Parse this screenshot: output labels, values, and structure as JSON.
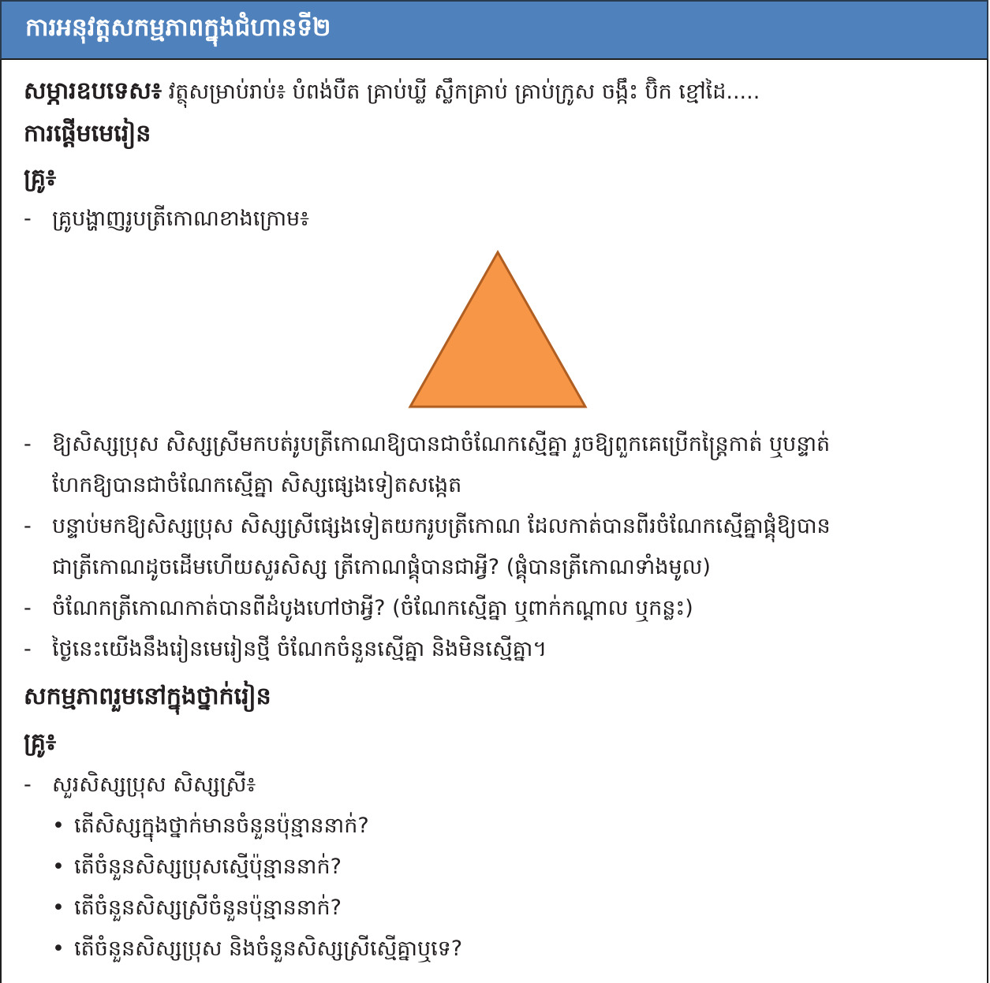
{
  "header": {
    "title": "ការអនុវត្តសកម្មភាពក្នុងជំហានទី២"
  },
  "materials": {
    "label": "សម្ភារឧបទេស៖",
    "text": "វត្ថុសម្រាប់រាប់៖ បំពង់បឺត គ្រាប់ឃ្លី  ស្លឹកគ្រាប់ គ្រាប់ក្រូស ចង្កឹះ ប៊ិក ខ្មៅដៃ....."
  },
  "intro": {
    "heading": "ការផ្តើមមេរៀន",
    "teacher_label": "គ្រូ៖",
    "dash": "-",
    "line1": "គ្រូបង្ហាញរូបត្រីកោណខាងក្រោម៖",
    "shape_color": "#f79646",
    "shape_stroke": "#b05e22",
    "line2a": "ឱ្យសិស្សប្រុស សិស្សស្រីមកបត់រូបត្រីកោណឱ្យបានជាចំណែកស្មើគ្នា រួចឱ្យពួកគេប្រើកន្ត្រៃកាត់ ឬបន្ទាត់",
    "line2b": "ហែកឱ្យបានជាចំណែកស្មើគ្នា សិស្សផ្សេងទៀតសង្កេត",
    "line3a": "បន្ទាប់មកឱ្យសិស្សប្រុស សិស្សស្រីផ្សេងទៀតយករូបត្រីកោណ ដែលកាត់បានពីរចំណែកស្មើគ្នាផ្គុំឱ្យបាន",
    "line3b": "ជាត្រីកោណដូចដើមហើយសួរសិស្ស ត្រីកោណផ្គុំបានជាអ្វី? (ផ្គុំបានត្រីកោណទាំងមូល)",
    "line4": "ចំណែកត្រីកោណកាត់បានពីដំបូងហៅថាអ្វី? (ចំណែកស្មើគ្នា ឬពាក់កណ្តាល ឬកន្លះ)",
    "line5": "ថ្ងៃនេះយើងនឹងរៀនមេរៀនថ្មី ចំណែកចំនួនស្មើគ្នា និងមិនស្មើគ្នា។"
  },
  "activity": {
    "heading": "សកម្មភាពរួមនៅក្នុងថ្នាក់រៀន",
    "teacher_label": "គ្រូ៖",
    "dash": "-",
    "line1": "សួរសិស្សប្រុស សិស្សស្រី៖",
    "bullet": "•",
    "questions": [
      "តើសិស្សក្នុងថ្នាក់មានចំនួនប៉ុន្មាននាក់?",
      "តើចំនួនសិស្សប្រុសស្មើប៉ុន្មាននាក់?",
      "តើចំនួនសិស្សស្រីចំនួនប៉ុន្មាននាក់?",
      "តើចំនួនសិស្សប្រុស និងចំនួនសិស្សស្រីស្មើគ្នាឬទេ?"
    ]
  }
}
